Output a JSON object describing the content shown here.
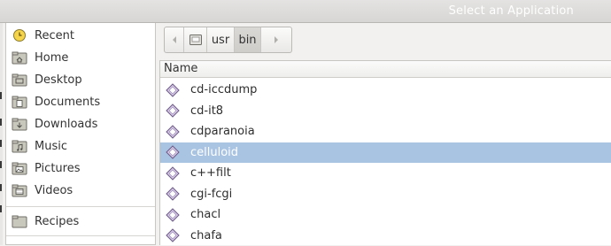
{
  "window": {
    "title": "Select an Application"
  },
  "sidebar": {
    "items": [
      {
        "label": "Recent",
        "icon": "recent-clock-icon"
      },
      {
        "label": "Home",
        "icon": "home-folder-icon"
      },
      {
        "label": "Desktop",
        "icon": "desktop-folder-icon"
      },
      {
        "label": "Documents",
        "icon": "documents-folder-icon"
      },
      {
        "label": "Downloads",
        "icon": "downloads-folder-icon"
      },
      {
        "label": "Music",
        "icon": "music-folder-icon"
      },
      {
        "label": "Pictures",
        "icon": "pictures-folder-icon"
      },
      {
        "label": "Videos",
        "icon": "videos-folder-icon"
      }
    ],
    "bookmarks": [
      {
        "label": "Recipes",
        "icon": "folder-icon"
      }
    ]
  },
  "pathbar": {
    "segments": [
      "usr",
      "bin"
    ],
    "active_segment": "bin"
  },
  "filelist": {
    "column_header": "Name",
    "rows": [
      {
        "name": "cd-iccdump",
        "selected": false
      },
      {
        "name": "cd-it8",
        "selected": false
      },
      {
        "name": "cdparanoia",
        "selected": false
      },
      {
        "name": "celluloid",
        "selected": true
      },
      {
        "name": "c++filt",
        "selected": false
      },
      {
        "name": "cgi-fcgi",
        "selected": false
      },
      {
        "name": "chacl",
        "selected": false
      },
      {
        "name": "chafa",
        "selected": false
      }
    ]
  },
  "colors": {
    "selection": "#a9c4e3",
    "title_text": "#ffffff"
  }
}
